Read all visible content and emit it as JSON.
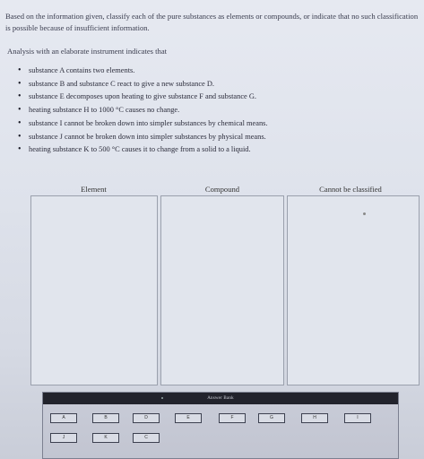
{
  "instructions": "Based on the information given, classify each of the pure substances as elements or compounds, or indicate that no such classification is possible because of insufficient information.",
  "analysis_intro": "Analysis with an elaborate instrument indicates that",
  "statements": [
    "substance A contains two elements.",
    "substance B and substance C react to give a new substance D.",
    "substance E decomposes upon heating to give substance F and substance G.",
    "heating substance H to 1000 °C causes no change.",
    "substance I cannot be broken down into simpler substances by chemical means.",
    "substance J cannot be broken down into simpler substances by physical means.",
    "heating substance K to 500 °C causes it to change from a solid to a liquid."
  ],
  "columns": {
    "element": "Element",
    "compound": "Compound",
    "cannot": "Cannot be classified"
  },
  "answer_bank": {
    "title": "Answer Bank",
    "row1": [
      "A",
      "B",
      "D",
      "E",
      "F",
      "G",
      "H",
      "I"
    ],
    "row2": [
      "J",
      "K",
      "C"
    ]
  }
}
